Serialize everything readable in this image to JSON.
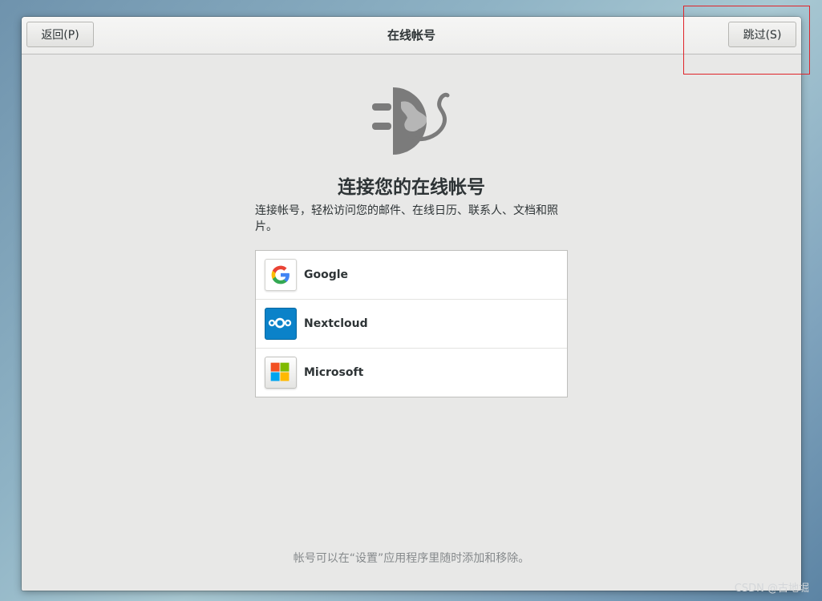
{
  "window": {
    "title": "在线帐号",
    "back_label": "返回(P)",
    "skip_label": "跳过(S)"
  },
  "main": {
    "hero_icon": "online-accounts-icon",
    "heading": "连接您的在线帐号",
    "description": "连接帐号，轻松访问您的邮件、在线日历、联系人、文档和照片。",
    "providers": [
      {
        "name": "Google",
        "icon": "google-icon"
      },
      {
        "name": "Nextcloud",
        "icon": "nextcloud-icon"
      },
      {
        "name": "Microsoft",
        "icon": "microsoft-icon"
      }
    ],
    "footnote": "帐号可以在“设置”应用程序里随时添加和移除。"
  },
  "overlay": {
    "highlight_color": "#e0242a",
    "watermark": "CSDN @古地堀"
  },
  "colors": {
    "window_bg": "#e8e8e7",
    "text": "#2e3436",
    "google_blue": "#4285f4",
    "google_red": "#ea4335",
    "google_yellow": "#fbbc05",
    "google_green": "#34a853",
    "nextcloud_blue": "#0b82c9",
    "ms_red": "#f25022",
    "ms_green": "#7fba00",
    "ms_blue": "#00a4ef",
    "ms_yellow": "#ffb900"
  }
}
